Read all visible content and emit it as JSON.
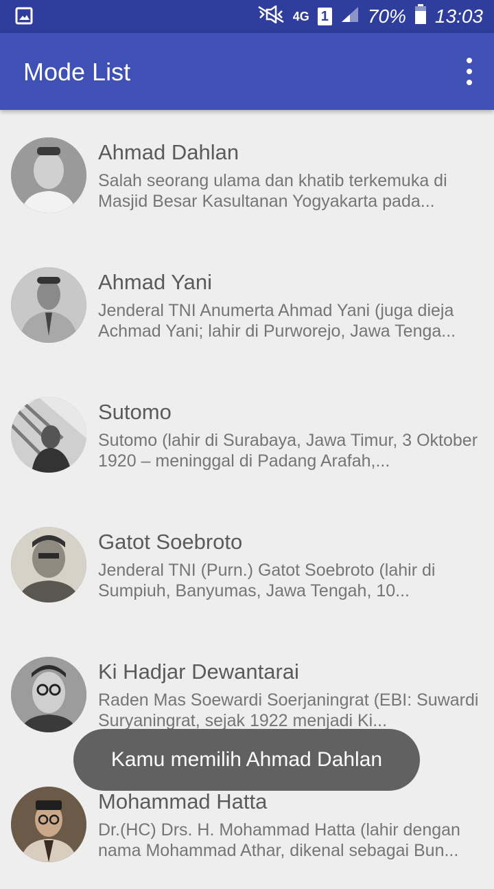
{
  "status_bar": {
    "network": "4G",
    "sim": "1",
    "battery": "70%",
    "time": "13:03",
    "icons": [
      "gallery-icon",
      "mute-icon",
      "signal-icon",
      "battery-icon"
    ]
  },
  "app_bar": {
    "title": "Mode List",
    "menu_icon": "more-vert-icon"
  },
  "items": [
    {
      "name": "Ahmad Dahlan",
      "desc": "Salah seorang ulama dan khatib terkemuka di Masjid Besar Kasultanan Yogyakarta pada..."
    },
    {
      "name": "Ahmad Yani",
      "desc": "Jenderal TNI Anumerta Ahmad Yani (juga dieja Achmad Yani; lahir di Purworejo, Jawa Tenga..."
    },
    {
      "name": "Sutomo",
      "desc": "Sutomo (lahir di Surabaya, Jawa Timur, 3 Oktober 1920 – meninggal di Padang Arafah,..."
    },
    {
      "name": "Gatot Soebroto",
      "desc": "Jenderal TNI (Purn.) Gatot Soebroto (lahir di Sumpiuh, Banyumas, Jawa Tengah, 10..."
    },
    {
      "name": "Ki Hadjar Dewantarai",
      "desc": "Raden Mas Soewardi Soerjaningrat (EBI: Suwardi Suryaningrat, sejak 1922 menjadi Ki..."
    },
    {
      "name": "Mohammad Hatta",
      "desc": "Dr.(HC) Drs. H. Mohammad Hatta (lahir dengan nama Mohammad Athar, dikenal sebagai Bun..."
    }
  ],
  "toast": "Kamu memilih Ahmad Dahlan",
  "colors": {
    "status_bar": "#2f3d9c",
    "app_bar": "#3f51b5",
    "background": "#eeeeee",
    "toast": "#616161"
  }
}
